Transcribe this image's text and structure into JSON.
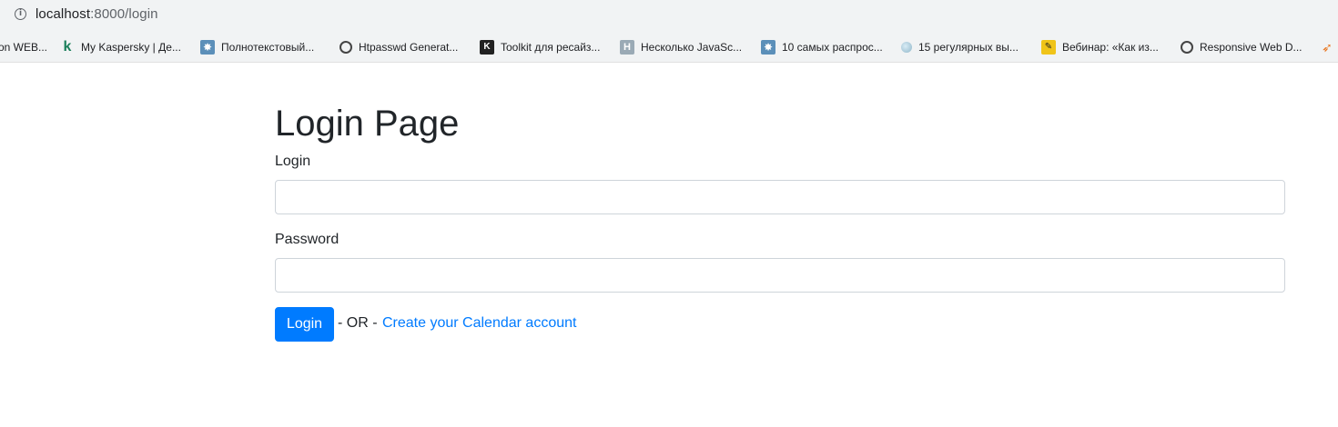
{
  "browser": {
    "url_host": "localhost",
    "url_path": ":8000/login",
    "bookmarks": [
      {
        "label": "on WEB...",
        "icon": "none"
      },
      {
        "label": "My Kaspersky | Де...",
        "icon": "kaspersky-icon"
      },
      {
        "label": "Полнотекстовый...",
        "icon": "star-burst-icon"
      },
      {
        "label": "Htpasswd Generat...",
        "icon": "globe-icon"
      },
      {
        "label": "Toolkit для ресайз...",
        "icon": "toolkit-icon"
      },
      {
        "label": "Несколько JavaSc...",
        "icon": "h-icon"
      },
      {
        "label": "10 самых распрос...",
        "icon": "star-burst-icon"
      },
      {
        "label": "15 регулярных вы...",
        "icon": "drop-icon"
      },
      {
        "label": "Вебинар: «Как из...",
        "icon": "yellow-badge-icon"
      },
      {
        "label": "Responsive Web D...",
        "icon": "globe-icon"
      }
    ]
  },
  "page": {
    "title": "Login Page",
    "login_label": "Login",
    "login_value": "",
    "password_label": "Password",
    "password_value": "",
    "submit_label": "Login",
    "or_text": "- OR -",
    "create_link": "Create your Calendar account"
  },
  "colors": {
    "primary": "#007bff",
    "text": "#212529",
    "border": "#ced4da",
    "chrome_bg": "#f1f3f4"
  }
}
